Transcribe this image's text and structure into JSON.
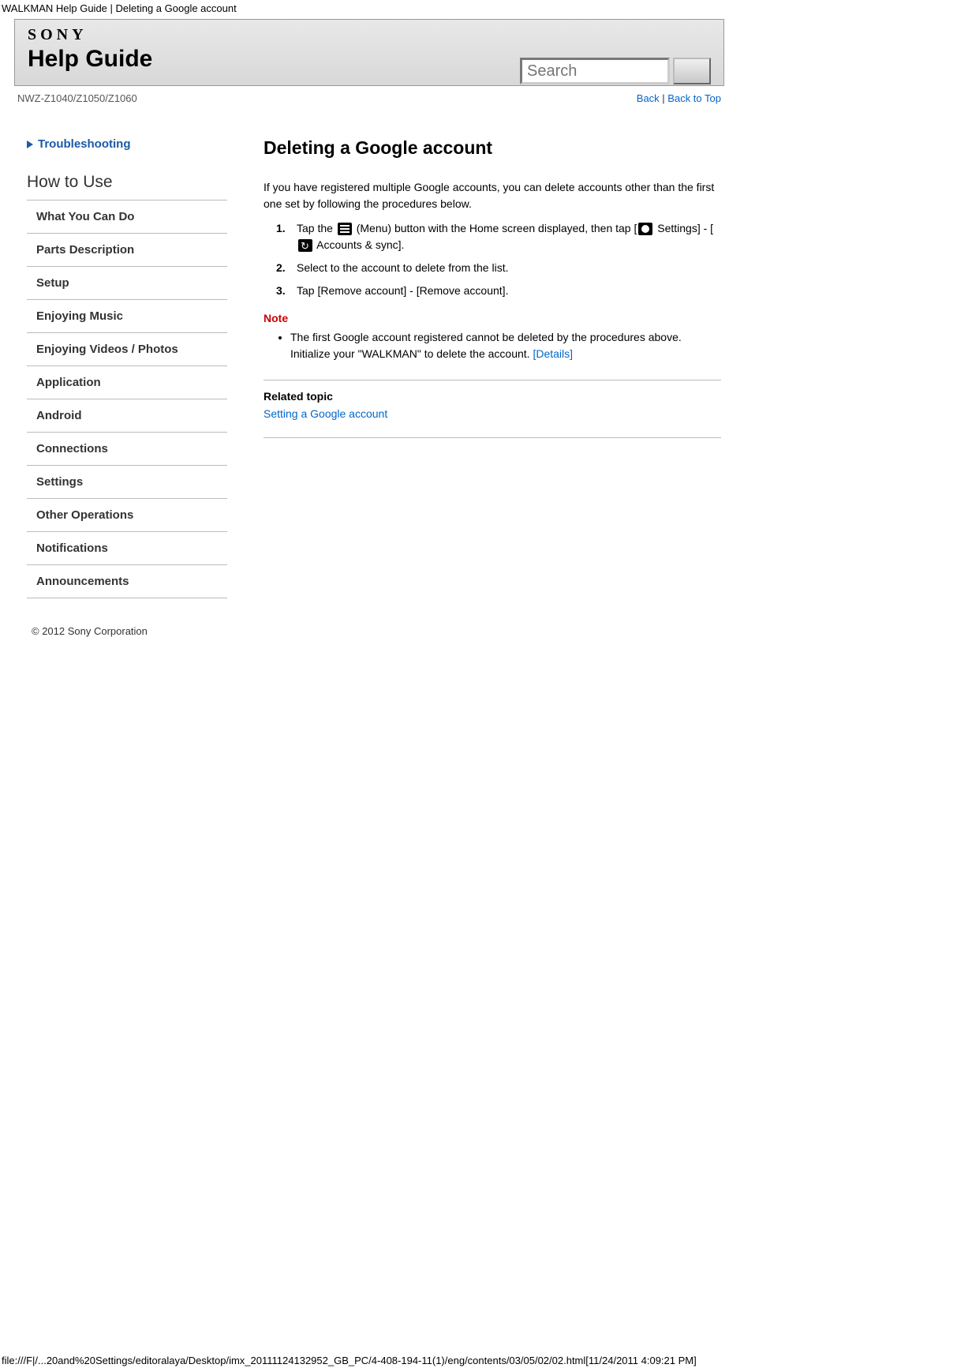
{
  "page_header": "WALKMAN Help Guide | Deleting a Google account",
  "brand": "SONY",
  "guide_title": "Help Guide",
  "search_placeholder": "Search",
  "model": "NWZ-Z1040/Z1050/Z1060",
  "links": {
    "back": "Back",
    "back_to_top": "Back to Top",
    "separator": " | "
  },
  "sidebar": {
    "troubleshooting": "Troubleshooting",
    "howto_title": "How to Use",
    "items": [
      "What You Can Do",
      "Parts Description",
      "Setup",
      "Enjoying Music",
      "Enjoying Videos / Photos",
      "Application",
      "Android",
      "Connections",
      "Settings",
      "Other Operations",
      "Notifications",
      "Announcements"
    ]
  },
  "content": {
    "title": "Deleting a Google account",
    "intro": "If you have registered multiple Google accounts, you can delete accounts other than the first one set by following the procedures below.",
    "steps": [
      {
        "num": "1.",
        "pre": "Tap the ",
        "icon1": "menu",
        "mid1": " (Menu) button with the Home screen displayed, then tap [",
        "icon2": "gear",
        "mid2": " Settings] - [",
        "icon3": "sync",
        "post": " Accounts & sync]."
      },
      {
        "num": "2.",
        "text": "Select to the account to delete from the list."
      },
      {
        "num": "3.",
        "text": "Tap [Remove account] - [Remove account]."
      }
    ],
    "note_label": "Note",
    "note_text": "The first Google account registered cannot be deleted by the procedures above. Initialize your \"WALKMAN\" to delete the account. ",
    "note_link": "[Details]",
    "related_title": "Related topic",
    "related_link": "Setting a Google account"
  },
  "copyright": "© 2012 Sony Corporation",
  "footer_path": "file:///F|/...20and%20Settings/editoralaya/Desktop/imx_20111124132952_GB_PC/4-408-194-11(1)/eng/contents/03/05/02/02.html[11/24/2011 4:09:21 PM]"
}
